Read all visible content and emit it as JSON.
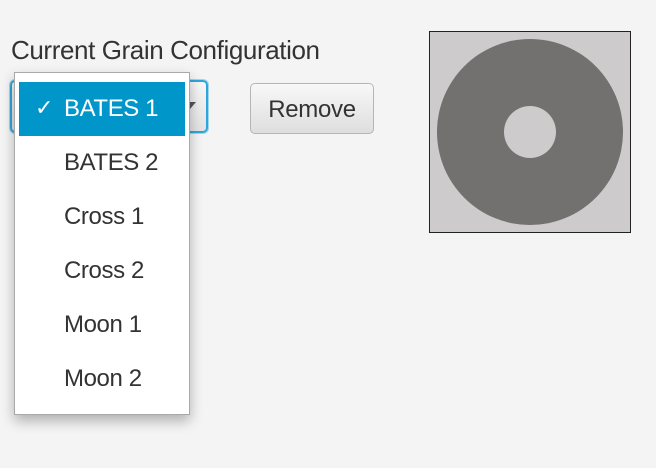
{
  "header": {
    "title": "Current Grain Configuration"
  },
  "grain_selector": {
    "selected_value": "BATES 1",
    "options": [
      "BATES 1",
      "BATES 2",
      "Cross 1",
      "Cross 2",
      "Moon 1",
      "Moon 2"
    ],
    "selected_index": 0
  },
  "toolbar": {
    "remove_label": "Remove"
  },
  "preview": {
    "background_color": "#cdcbcb",
    "grain_color": "#737070",
    "core_color": "#cdcbcb"
  },
  "colors": {
    "accent": "#0096c9",
    "focus_border": "#2ea6dc"
  },
  "icons": {
    "check": "checkmark-icon",
    "arrow": "chevron-down-icon"
  }
}
